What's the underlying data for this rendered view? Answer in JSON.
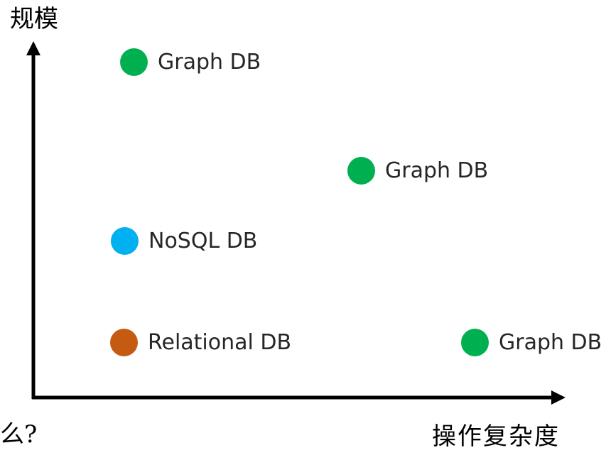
{
  "axes": {
    "y_label": "规模",
    "x_label": "操作复杂度",
    "partial_left_text": "么?"
  },
  "points": [
    {
      "label": "Graph DB",
      "color": "#00b050"
    },
    {
      "label": "Graph DB",
      "color": "#00b050"
    },
    {
      "label": "NoSQL DB",
      "color": "#00b0f0"
    },
    {
      "label": "Relational DB",
      "color": "#c55a11"
    },
    {
      "label": "Graph DB",
      "color": "#00b050"
    }
  ],
  "colors": {
    "axis": "#000000",
    "text": "#262626"
  }
}
